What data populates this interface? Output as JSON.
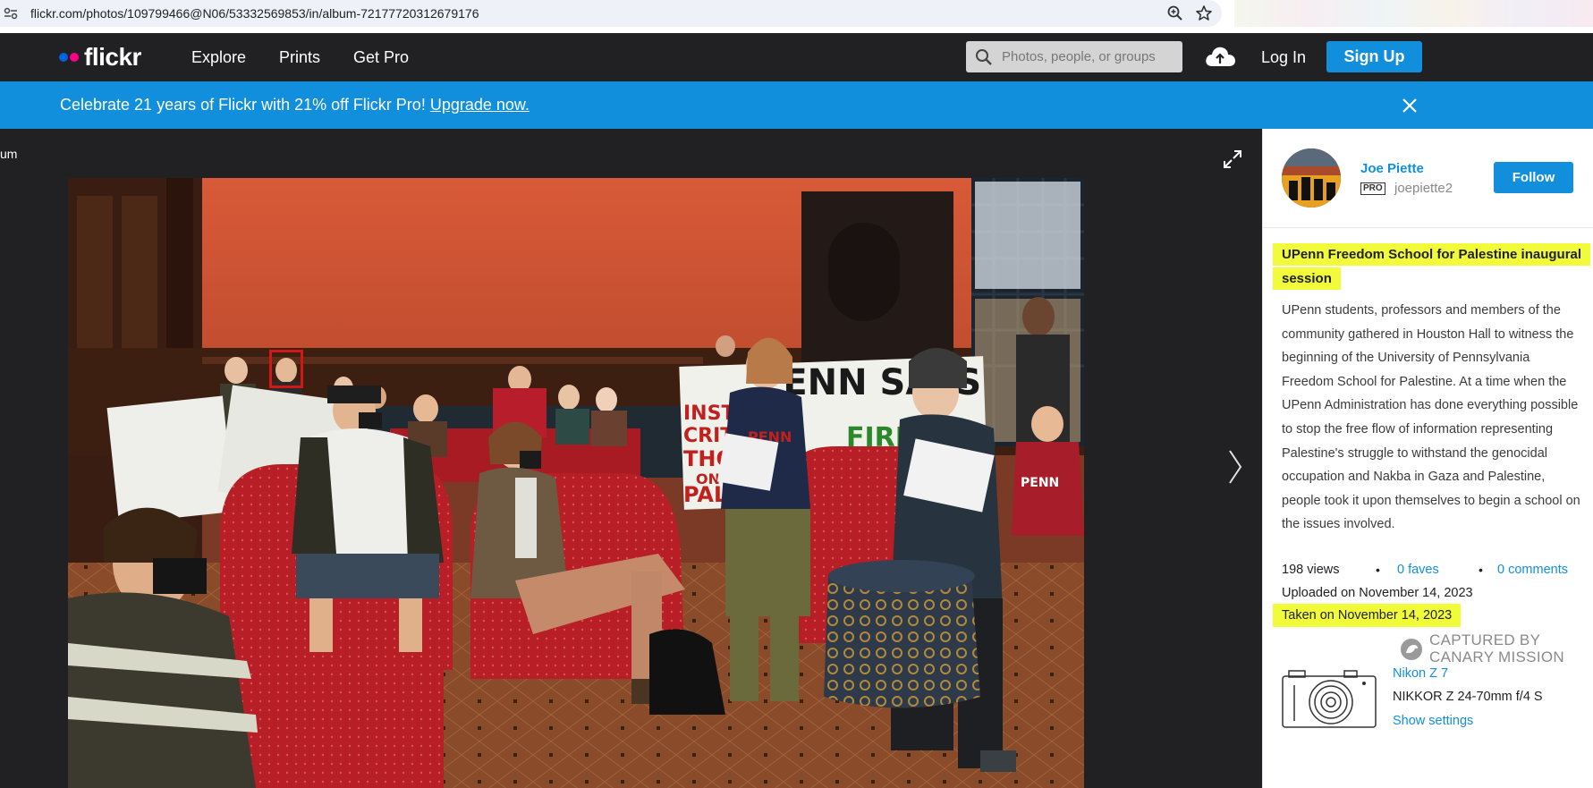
{
  "browser": {
    "url": "flickr.com/photos/109799466@N06/53332569853/in/album-72177720312679176"
  },
  "header": {
    "logo": "flickr",
    "nav": [
      "Explore",
      "Prints",
      "Get Pro"
    ],
    "search_placeholder": "Photos, people, or groups",
    "login": "Log In",
    "signup": "Sign Up"
  },
  "promo": {
    "text": "Celebrate 21 years of Flickr with 21% off Flickr Pro! ",
    "link": "Upgrade now."
  },
  "stage": {
    "album_crumb": "um"
  },
  "photo": {
    "banner_text_1": "PENN SAYS",
    "banner_text_2": "INSTI",
    "banner_text_3": "CRITI",
    "banner_text_4": "THOU",
    "banner_text_5": "ON",
    "banner_text_6": "PALES",
    "banner_text_7": "FIRE",
    "sweatshirt_1": "PENN",
    "sweatshirt_2": "PENN"
  },
  "owner": {
    "name": "Joe Piette",
    "pro": "PRO",
    "handle": "joepiette2",
    "follow": "Follow"
  },
  "details": {
    "title_line1": "UPenn Freedom School for Palestine inaugural",
    "title_line2": "session",
    "description": "UPenn students, professors and members of the community gathered in Houston Hall to witness the beginning of the University of Pennsylvania Freedom School for Palestine. At a time when the UPenn Administration has done everything possible to stop the free flow of information representing Palestine's struggle to withstand the genocidal occupation and Nakba in Gaza and Palestine, people took it upon themselves to begin a school on the issues involved.",
    "views": "198 views",
    "faves": "0 faves",
    "comments": "0 comments",
    "sep": "•",
    "uploaded": "Uploaded on November 14, 2023",
    "taken": "Taken on November 14, 2023"
  },
  "watermark": {
    "line1": "CAPTURED BY",
    "line2": "CANARY MISSION"
  },
  "camera": {
    "model": "Nikon Z 7",
    "lens": "NIKKOR Z 24-70mm f/4 S",
    "settings": "Show settings"
  },
  "colors": {
    "flickr_blue": "#128fdc",
    "header_bg": "#212124",
    "highlight": "#f1fb3a",
    "logo_blue": "#0063dc",
    "logo_pink": "#ff0084"
  }
}
